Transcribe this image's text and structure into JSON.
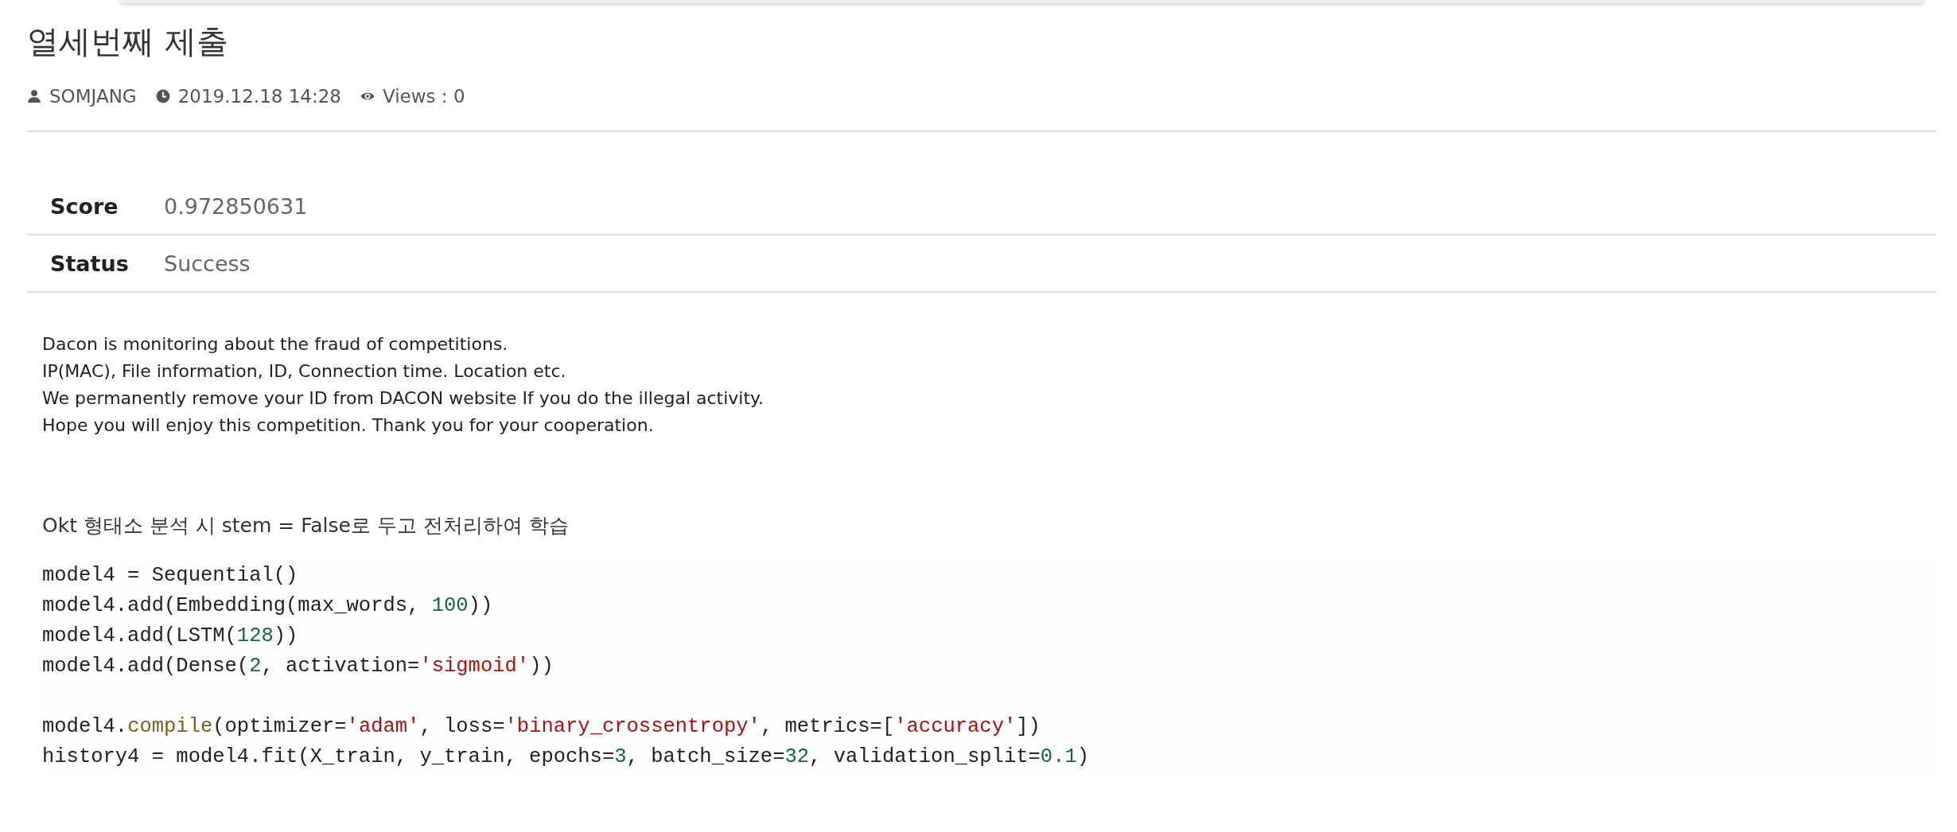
{
  "title": "열세번째 제출",
  "meta": {
    "author": "SOMJANG",
    "datetime": "2019.12.18 14:28",
    "views": "Views : 0"
  },
  "details": [
    {
      "label": "Score",
      "value": "0.972850631"
    },
    {
      "label": "Status",
      "value": "Success"
    }
  ],
  "notice": [
    "Dacon is monitoring about the fraud of competitions.",
    "IP(MAC), File information, ID, Connection time. Location etc.",
    "We permanently remove your ID from DACON website If you do the illegal activity.",
    "Hope you will enjoy this competition. Thank you for your cooperation."
  ],
  "description": "Okt 형태소 분석 시 stem = False로 두고 전처리하여 학습",
  "code_blocks": [
    [
      [
        {
          "kind": "plain",
          "text": "model4 = Sequential()"
        }
      ],
      [
        {
          "kind": "plain",
          "text": "model4.add(Embedding(max_words, "
        },
        {
          "kind": "number",
          "text": "100"
        },
        {
          "kind": "plain",
          "text": "))"
        }
      ],
      [
        {
          "kind": "plain",
          "text": "model4.add(LSTM("
        },
        {
          "kind": "number",
          "text": "128"
        },
        {
          "kind": "plain",
          "text": "))"
        }
      ],
      [
        {
          "kind": "plain",
          "text": "model4.add(Dense("
        },
        {
          "kind": "number",
          "text": "2"
        },
        {
          "kind": "plain",
          "text": ", activation="
        },
        {
          "kind": "string",
          "text": "'sigmoid'"
        },
        {
          "kind": "plain",
          "text": "))"
        }
      ]
    ],
    [
      [
        {
          "kind": "plain",
          "text": "model4."
        },
        {
          "kind": "function",
          "text": "compile"
        },
        {
          "kind": "plain",
          "text": "(optimizer="
        },
        {
          "kind": "string",
          "text": "'adam'"
        },
        {
          "kind": "plain",
          "text": ", loss="
        },
        {
          "kind": "string",
          "text": "'binary_crossentropy'"
        },
        {
          "kind": "plain",
          "text": ", metrics=["
        },
        {
          "kind": "string",
          "text": "'accuracy'"
        },
        {
          "kind": "plain",
          "text": "])"
        }
      ],
      [
        {
          "kind": "plain",
          "text": "history4 = model4.fit(X_train, y_train, epochs="
        },
        {
          "kind": "number",
          "text": "3"
        },
        {
          "kind": "plain",
          "text": ", batch_size="
        },
        {
          "kind": "number",
          "text": "32"
        },
        {
          "kind": "plain",
          "text": ", validation_split="
        },
        {
          "kind": "number",
          "text": "0.1"
        },
        {
          "kind": "plain",
          "text": ")"
        }
      ]
    ]
  ]
}
